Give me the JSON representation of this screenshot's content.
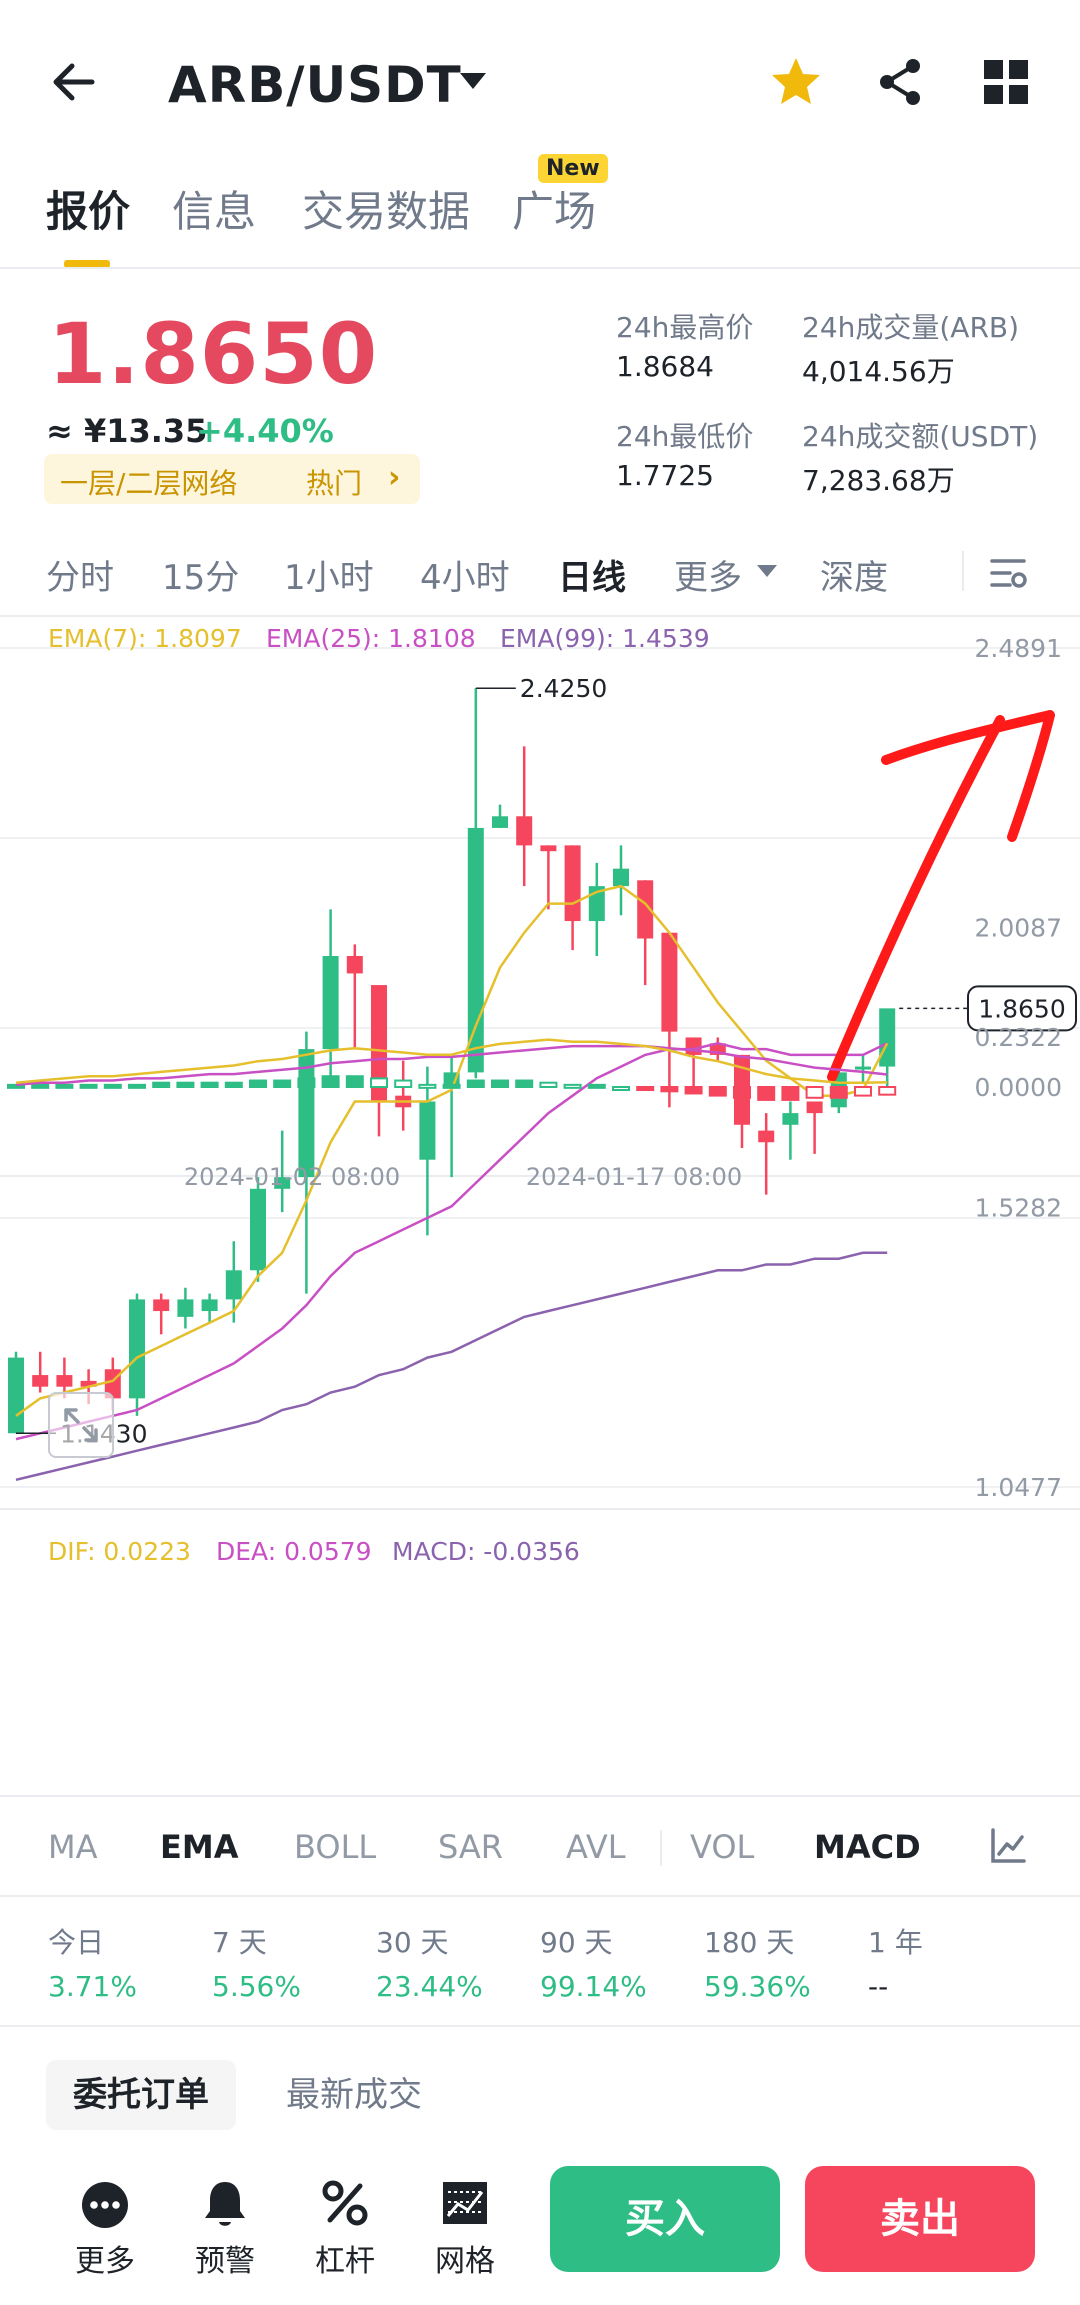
{
  "header": {
    "pair": "ARB/USDT",
    "tabs": [
      "报价",
      "信息",
      "交易数据",
      "广场"
    ],
    "new_badge": "New"
  },
  "price": {
    "last": "1.8650",
    "fiat": "≈ ¥13.35",
    "change": "+4.40%",
    "tag": "一层/二层网络",
    "tag_hot": "热门",
    "stats": {
      "high_label": "24h最高价",
      "high": "1.8684",
      "vol_arb_label": "24h成交量(ARB)",
      "vol_arb": "4,014.56万",
      "low_label": "24h最低价",
      "low": "1.7725",
      "vol_usdt_label": "24h成交额(USDT)",
      "vol_usdt": "7,283.68万"
    }
  },
  "intervals": [
    "分时",
    "15分",
    "1小时",
    "4小时",
    "日线",
    "更多",
    "深度"
  ],
  "ema_legend": {
    "ema7": "EMA(7): 1.8097",
    "ema25": "EMA(25): 1.8108",
    "ema99": "EMA(99): 1.4539"
  },
  "macd_legend": {
    "dif": "DIF: 0.0223",
    "dea": "DEA: 0.0579",
    "macd": "MACD: -0.0356"
  },
  "colors": {
    "up": "#2ebd85",
    "down": "#f6465d",
    "ema7": "#e5bf2c",
    "ema25": "#c94fc4",
    "ema99": "#8a62ad",
    "accent": "#f0b90b"
  },
  "chart_data": {
    "type": "candlestick",
    "interval": "1d",
    "price_axis_labels": [
      "2.4891",
      "2.0087",
      "1.5282",
      "1.0477"
    ],
    "macd_axis_labels": [
      "0.2322",
      "0.0000"
    ],
    "price_ylim": [
      1.0477,
      2.4891
    ],
    "macd_ylim": [
      -0.06,
      0.2322
    ],
    "time_labels": [
      "2024-01-02 08:00",
      "2024-01-17 08:00"
    ],
    "high_marker": "2.4250",
    "low_marker": "1.1430",
    "current_price_tag": "1.8650",
    "candles": [
      {
        "o": 1.14,
        "h": 1.28,
        "l": 1.14,
        "c": 1.27
      },
      {
        "o": 1.24,
        "h": 1.28,
        "l": 1.21,
        "c": 1.22
      },
      {
        "o": 1.24,
        "h": 1.27,
        "l": 1.2,
        "c": 1.22
      },
      {
        "o": 1.23,
        "h": 1.25,
        "l": 1.19,
        "c": 1.22
      },
      {
        "o": 1.25,
        "h": 1.27,
        "l": 1.18,
        "c": 1.2
      },
      {
        "o": 1.2,
        "h": 1.38,
        "l": 1.17,
        "c": 1.37
      },
      {
        "o": 1.37,
        "h": 1.38,
        "l": 1.31,
        "c": 1.35
      },
      {
        "o": 1.34,
        "h": 1.39,
        "l": 1.32,
        "c": 1.37
      },
      {
        "o": 1.35,
        "h": 1.38,
        "l": 1.33,
        "c": 1.37
      },
      {
        "o": 1.37,
        "h": 1.47,
        "l": 1.33,
        "c": 1.42
      },
      {
        "o": 1.42,
        "h": 1.58,
        "l": 1.4,
        "c": 1.56
      },
      {
        "o": 1.56,
        "h": 1.66,
        "l": 1.52,
        "c": 1.58
      },
      {
        "o": 1.58,
        "h": 1.83,
        "l": 1.38,
        "c": 1.8
      },
      {
        "o": 1.8,
        "h": 2.04,
        "l": 1.75,
        "c": 1.96
      },
      {
        "o": 1.96,
        "h": 1.98,
        "l": 1.8,
        "c": 1.93
      },
      {
        "o": 1.91,
        "h": 1.91,
        "l": 1.65,
        "c": 1.71
      },
      {
        "o": 1.72,
        "h": 1.78,
        "l": 1.66,
        "c": 1.7
      },
      {
        "o": 1.61,
        "h": 1.77,
        "l": 1.48,
        "c": 1.71
      },
      {
        "o": 1.74,
        "h": 1.79,
        "l": 1.58,
        "c": 1.76
      },
      {
        "o": 1.76,
        "h": 2.42,
        "l": 1.75,
        "c": 2.18
      },
      {
        "o": 2.18,
        "h": 2.22,
        "l": 2.18,
        "c": 2.2
      },
      {
        "o": 2.2,
        "h": 2.32,
        "l": 2.08,
        "c": 2.15
      },
      {
        "o": 2.15,
        "h": 2.15,
        "l": 2.04,
        "c": 2.14
      },
      {
        "o": 2.15,
        "h": 2.15,
        "l": 1.97,
        "c": 2.02
      },
      {
        "o": 2.02,
        "h": 2.12,
        "l": 1.96,
        "c": 2.08
      },
      {
        "o": 2.08,
        "h": 2.15,
        "l": 2.03,
        "c": 2.11
      },
      {
        "o": 2.09,
        "h": 2.09,
        "l": 1.91,
        "c": 1.99
      },
      {
        "o": 2.0,
        "h": 2.0,
        "l": 1.7,
        "c": 1.83
      },
      {
        "o": 1.82,
        "h": 1.82,
        "l": 1.73,
        "c": 1.79
      },
      {
        "o": 1.81,
        "h": 1.82,
        "l": 1.78,
        "c": 1.79
      },
      {
        "o": 1.79,
        "h": 1.79,
        "l": 1.63,
        "c": 1.67
      },
      {
        "o": 1.66,
        "h": 1.69,
        "l": 1.55,
        "c": 1.64
      },
      {
        "o": 1.67,
        "h": 1.71,
        "l": 1.61,
        "c": 1.69
      },
      {
        "o": 1.71,
        "h": 1.71,
        "l": 1.62,
        "c": 1.69
      },
      {
        "o": 1.7,
        "h": 1.77,
        "l": 1.69,
        "c": 1.76
      },
      {
        "o": 1.77,
        "h": 1.79,
        "l": 1.74,
        "c": 1.77
      },
      {
        "o": 1.77,
        "h": 1.83,
        "l": 1.73,
        "c": 1.87
      }
    ],
    "ema7": [
      1.17,
      1.2,
      1.21,
      1.22,
      1.23,
      1.27,
      1.29,
      1.31,
      1.33,
      1.35,
      1.41,
      1.45,
      1.54,
      1.64,
      1.71,
      1.71,
      1.71,
      1.71,
      1.73,
      1.84,
      1.94,
      2.0,
      2.05,
      2.05,
      2.07,
      2.08,
      2.05,
      2.0,
      1.94,
      1.88,
      1.83,
      1.78,
      1.75,
      1.72,
      1.72,
      1.73,
      1.81
    ],
    "ema25": [
      1.13,
      1.14,
      1.15,
      1.16,
      1.17,
      1.18,
      1.2,
      1.22,
      1.24,
      1.26,
      1.29,
      1.32,
      1.36,
      1.41,
      1.45,
      1.47,
      1.49,
      1.51,
      1.53,
      1.57,
      1.61,
      1.65,
      1.69,
      1.72,
      1.75,
      1.77,
      1.79,
      1.8,
      1.8,
      1.81,
      1.8,
      1.8,
      1.79,
      1.79,
      1.79,
      1.79,
      1.81
    ],
    "ema99": [
      1.06,
      1.07,
      1.08,
      1.09,
      1.1,
      1.11,
      1.12,
      1.13,
      1.14,
      1.15,
      1.16,
      1.18,
      1.19,
      1.21,
      1.22,
      1.24,
      1.25,
      1.27,
      1.28,
      1.3,
      1.32,
      1.34,
      1.35,
      1.36,
      1.37,
      1.38,
      1.39,
      1.4,
      1.41,
      1.42,
      1.42,
      1.43,
      1.43,
      1.44,
      1.44,
      1.45,
      1.45
    ],
    "dif": [
      0.02,
      0.03,
      0.04,
      0.05,
      0.05,
      0.06,
      0.07,
      0.08,
      0.09,
      0.1,
      0.12,
      0.13,
      0.15,
      0.17,
      0.18,
      0.17,
      0.16,
      0.15,
      0.15,
      0.18,
      0.2,
      0.21,
      0.22,
      0.21,
      0.21,
      0.2,
      0.19,
      0.17,
      0.14,
      0.12,
      0.09,
      0.06,
      0.04,
      0.03,
      0.02,
      0.02,
      0.0223
    ],
    "dea": [
      0.01,
      0.02,
      0.02,
      0.03,
      0.03,
      0.04,
      0.04,
      0.05,
      0.06,
      0.06,
      0.07,
      0.08,
      0.09,
      0.11,
      0.12,
      0.13,
      0.13,
      0.14,
      0.14,
      0.15,
      0.16,
      0.17,
      0.18,
      0.19,
      0.19,
      0.19,
      0.19,
      0.18,
      0.17,
      0.16,
      0.14,
      0.13,
      0.11,
      0.09,
      0.08,
      0.07,
      0.0579
    ],
    "macd": [
      0.01,
      0.01,
      0.01,
      0.01,
      0.01,
      0.01,
      0.02,
      0.02,
      0.02,
      0.02,
      0.03,
      0.03,
      0.04,
      0.05,
      0.05,
      0.04,
      0.03,
      0.01,
      0.01,
      0.03,
      0.03,
      0.03,
      0.02,
      0.01,
      0.01,
      0.0,
      -0.01,
      -0.02,
      -0.03,
      -0.04,
      -0.05,
      -0.06,
      -0.06,
      -0.05,
      -0.05,
      -0.04,
      -0.0356
    ]
  },
  "indicator_tabs": [
    "MA",
    "EMA",
    "BOLL",
    "SAR",
    "AVL",
    "VOL",
    "MACD"
  ],
  "performance": [
    {
      "label": "今日",
      "value": "3.71%"
    },
    {
      "label": "7 天",
      "value": "5.56%"
    },
    {
      "label": "30 天",
      "value": "23.44%"
    },
    {
      "label": "90 天",
      "value": "99.14%"
    },
    {
      "label": "180 天",
      "value": "59.36%"
    },
    {
      "label": "1 年",
      "value": "--"
    }
  ],
  "order_tabs": [
    "委托订单",
    "最新成交"
  ],
  "bottom_bar": [
    "更多",
    "预警",
    "杠杆",
    "网格"
  ],
  "actions": {
    "buy": "买入",
    "sell": "卖出"
  }
}
